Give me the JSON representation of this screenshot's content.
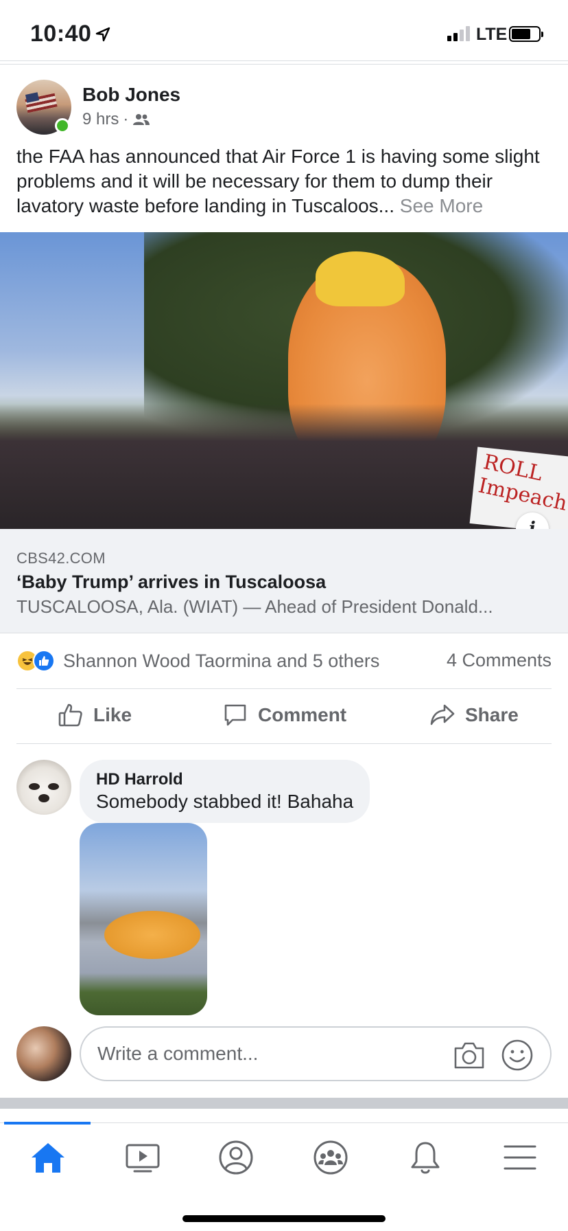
{
  "status_bar": {
    "time": "10:40",
    "network": "LTE",
    "signal_bars_filled": 2,
    "signal_bars_total": 4,
    "battery_level": 0.72
  },
  "post": {
    "author": "Bob Jones",
    "time": "9 hrs",
    "separator": "·",
    "audience_icon": "friends-icon",
    "online": true,
    "text": "the FAA has announced that Air Force 1 is having some slight problems and it will be necessary for them to dump their lavatory waste before landing in Tuscaloos...",
    "see_more": "See More"
  },
  "link_preview": {
    "domain": "CBS42.COM",
    "title": "‘Baby Trump’ arrives in Tuscaloosa",
    "description": "TUSCALOOSA, Ala. (WIAT) — Ahead of President Donald...",
    "info_label": "i",
    "banner_text": "ROLL Impeach"
  },
  "engagement": {
    "reactors": "Shannon Wood Taormina and 5 others",
    "comments": "4 Comments",
    "reaction_icons": [
      "haha-icon",
      "like-icon"
    ]
  },
  "actions": {
    "like": "Like",
    "comment": "Comment",
    "share": "Share"
  },
  "comment": {
    "author": "HD Harrold",
    "text": "Somebody stabbed it! Bahaha"
  },
  "composer": {
    "placeholder": "Write a comment..."
  },
  "tab_bar": {
    "tabs": [
      "home-icon",
      "watch-icon",
      "profile-icon",
      "groups-icon",
      "notifications-icon",
      "menu-icon"
    ],
    "active": "home-icon"
  },
  "colors": {
    "accent": "#1877f2",
    "secondary_text": "#65676b",
    "online_green": "#42b72a",
    "caption_bg": "#f0f2f5"
  }
}
